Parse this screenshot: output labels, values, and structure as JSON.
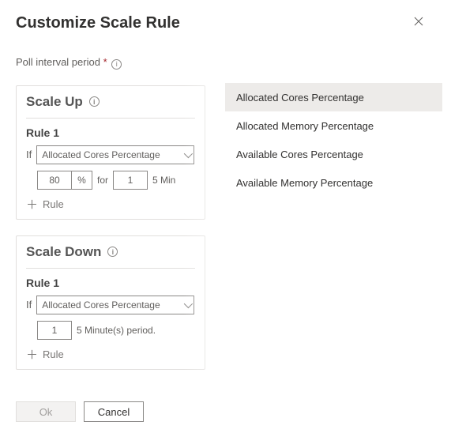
{
  "header": {
    "title": "Customize Scale Rule"
  },
  "poll": {
    "label": "Poll interval period",
    "required_mark": "*"
  },
  "scaleUp": {
    "heading": "Scale Up",
    "rule1": {
      "title": "Rule 1",
      "if": "If",
      "metric": "Allocated Cores Percentage",
      "threshold": "80",
      "pct": "%",
      "for": "for",
      "duration": "1",
      "trail": "5 Min"
    },
    "add_rule": "Rule"
  },
  "scaleDown": {
    "heading": "Scale Down",
    "rule1": {
      "title": "Rule 1",
      "if": "If",
      "metric": "Allocated Cores Percentage",
      "duration": "1",
      "trail": "5 Minute(s) period."
    },
    "add_rule": "Rule"
  },
  "footer": {
    "ok": "Ok",
    "cancel": "Cancel"
  },
  "dropdown": {
    "options": [
      "Allocated Cores Percentage",
      "Allocated Memory Percentage",
      "Available Cores Percentage",
      "Available Memory Percentage"
    ],
    "selected_index": 0
  }
}
